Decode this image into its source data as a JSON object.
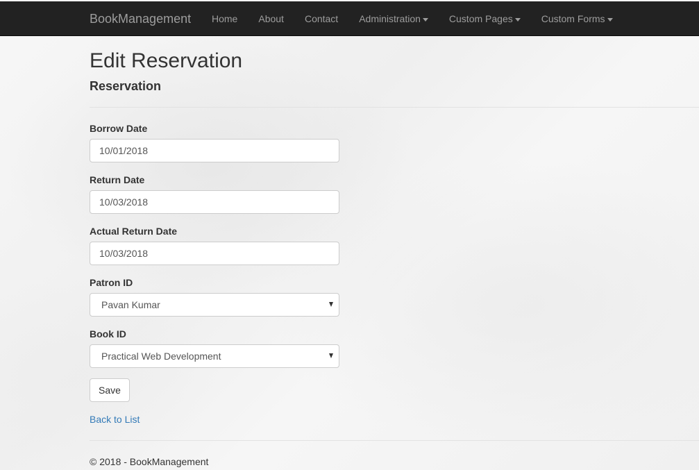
{
  "navbar": {
    "brand": "BookManagement",
    "items": [
      {
        "label": "Home"
      },
      {
        "label": "About"
      },
      {
        "label": "Contact"
      },
      {
        "label": "Administration"
      },
      {
        "label": "Custom Pages"
      },
      {
        "label": "Custom Forms"
      }
    ]
  },
  "page": {
    "title": "Edit Reservation",
    "subtitle": "Reservation"
  },
  "form": {
    "borrow_date": {
      "label": "Borrow Date",
      "value": "10/01/2018"
    },
    "return_date": {
      "label": "Return Date",
      "value": "10/03/2018"
    },
    "actual_return_date": {
      "label": "Actual Return Date",
      "value": "10/03/2018"
    },
    "patron_id": {
      "label": "Patron ID",
      "value": "Pavan Kumar"
    },
    "book_id": {
      "label": "Book ID",
      "value": "Practical Web Development"
    },
    "save_label": "Save"
  },
  "back_link": "Back to List",
  "footer": "© 2018 - BookManagement",
  "colors": {
    "navbar_bg": "#222222",
    "nav_text": "#9d9d9d",
    "link": "#337ab7"
  }
}
